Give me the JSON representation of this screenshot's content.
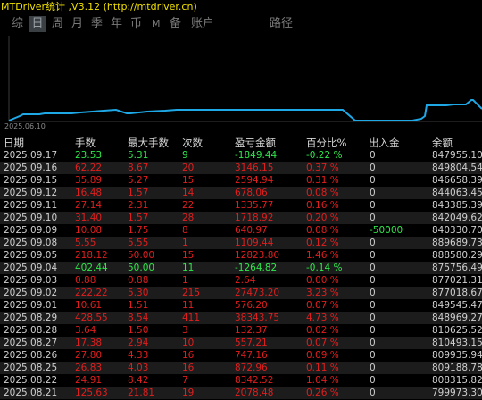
{
  "title": "MTDriver统计 ,V3.12 (http://mtdriver.cn)",
  "tabs": [
    {
      "label": "综",
      "active": false
    },
    {
      "label": "日",
      "active": true
    },
    {
      "label": "周",
      "active": false
    },
    {
      "label": "月",
      "active": false
    },
    {
      "label": "季",
      "active": false
    },
    {
      "label": "年",
      "active": false
    },
    {
      "label": "币",
      "active": false
    },
    {
      "label": "M",
      "active": false
    },
    {
      "label": "备",
      "active": false
    },
    {
      "label": "账户",
      "active": false
    },
    {
      "label": "路径",
      "active": false
    }
  ],
  "chart": {
    "start_date": "2025.06.10",
    "line_color": "#1ea8e6"
  },
  "colors": {
    "title": "#f0e000",
    "positive": "#e01e1e",
    "negative": "#2ee64a",
    "row_alt": "#1c1c1c"
  },
  "table": {
    "headers": {
      "date": "日期",
      "lots": "手数",
      "max_lots": "最大手数",
      "count": "次数",
      "pnl": "盈亏金额",
      "pct": "百分比%",
      "inout": "出入金",
      "balance": "余额"
    },
    "rows": [
      {
        "date": "2025.09.17",
        "lots": "23.53",
        "max_lots": "5.31",
        "count": "9",
        "pnl": "-1849.44",
        "pct": "-0.22 %",
        "inout": "0",
        "balance": "847955.10",
        "sign": "neg"
      },
      {
        "date": "2025.09.16",
        "lots": "62.22",
        "max_lots": "8.67",
        "count": "20",
        "pnl": "3146.15",
        "pct": "0.37 %",
        "inout": "0",
        "balance": "849804.54",
        "sign": "pos"
      },
      {
        "date": "2025.09.15",
        "lots": "35.89",
        "max_lots": "5.27",
        "count": "15",
        "pnl": "2594.94",
        "pct": "0.31 %",
        "inout": "0",
        "balance": "846658.39",
        "sign": "pos"
      },
      {
        "date": "2025.09.12",
        "lots": "16.48",
        "max_lots": "1.57",
        "count": "14",
        "pnl": "678.06",
        "pct": "0.08 %",
        "inout": "0",
        "balance": "844063.45",
        "sign": "pos"
      },
      {
        "date": "2025.09.11",
        "lots": "27.14",
        "max_lots": "2.31",
        "count": "22",
        "pnl": "1335.77",
        "pct": "0.16 %",
        "inout": "0",
        "balance": "843385.39",
        "sign": "pos"
      },
      {
        "date": "2025.09.10",
        "lots": "31.40",
        "max_lots": "1.57",
        "count": "28",
        "pnl": "1718.92",
        "pct": "0.20 %",
        "inout": "0",
        "balance": "842049.62",
        "sign": "pos"
      },
      {
        "date": "2025.09.09",
        "lots": "10.08",
        "max_lots": "1.75",
        "count": "8",
        "pnl": "640.97",
        "pct": "0.08 %",
        "inout": "-50000",
        "balance": "840330.70",
        "sign": "pos",
        "io_highlight": true
      },
      {
        "date": "2025.09.08",
        "lots": "5.55",
        "max_lots": "5.55",
        "count": "1",
        "pnl": "1109.44",
        "pct": "0.12 %",
        "inout": "0",
        "balance": "889689.73",
        "sign": "pos"
      },
      {
        "date": "2025.09.05",
        "lots": "218.12",
        "max_lots": "50.00",
        "count": "15",
        "pnl": "12823.80",
        "pct": "1.46 %",
        "inout": "0",
        "balance": "888580.29",
        "sign": "pos"
      },
      {
        "date": "2025.09.04",
        "lots": "402.44",
        "max_lots": "50.00",
        "count": "11",
        "pnl": "-1264.82",
        "pct": "-0.14 %",
        "inout": "0",
        "balance": "875756.49",
        "sign": "neg"
      },
      {
        "date": "2025.09.03",
        "lots": "0.88",
        "max_lots": "0.88",
        "count": "1",
        "pnl": "2.64",
        "pct": "0.00 %",
        "inout": "0",
        "balance": "877021.31",
        "sign": "pos"
      },
      {
        "date": "2025.09.02",
        "lots": "222.22",
        "max_lots": "5.30",
        "count": "215",
        "pnl": "27473.20",
        "pct": "3.23 %",
        "inout": "0",
        "balance": "877018.67",
        "sign": "pos"
      },
      {
        "date": "2025.09.01",
        "lots": "10.61",
        "max_lots": "1.51",
        "count": "11",
        "pnl": "576.20",
        "pct": "0.07 %",
        "inout": "0",
        "balance": "849545.47",
        "sign": "pos"
      },
      {
        "date": "2025.08.29",
        "lots": "428.55",
        "max_lots": "8.54",
        "count": "411",
        "pnl": "38343.75",
        "pct": "4.73 %",
        "inout": "0",
        "balance": "848969.27",
        "sign": "pos"
      },
      {
        "date": "2025.08.28",
        "lots": "3.64",
        "max_lots": "1.50",
        "count": "3",
        "pnl": "132.37",
        "pct": "0.02 %",
        "inout": "0",
        "balance": "810625.52",
        "sign": "pos"
      },
      {
        "date": "2025.08.27",
        "lots": "17.38",
        "max_lots": "2.94",
        "count": "10",
        "pnl": "557.21",
        "pct": "0.07 %",
        "inout": "0",
        "balance": "810493.15",
        "sign": "pos"
      },
      {
        "date": "2025.08.26",
        "lots": "27.80",
        "max_lots": "4.33",
        "count": "16",
        "pnl": "747.16",
        "pct": "0.09 %",
        "inout": "0",
        "balance": "809935.94",
        "sign": "pos"
      },
      {
        "date": "2025.08.25",
        "lots": "26.83",
        "max_lots": "4.03",
        "count": "16",
        "pnl": "872.96",
        "pct": "0.11 %",
        "inout": "0",
        "balance": "809188.78",
        "sign": "pos"
      },
      {
        "date": "2025.08.22",
        "lots": "24.91",
        "max_lots": "8.42",
        "count": "7",
        "pnl": "8342.52",
        "pct": "1.04 %",
        "inout": "0",
        "balance": "808315.82",
        "sign": "pos"
      },
      {
        "date": "2025.08.21",
        "lots": "125.63",
        "max_lots": "21.81",
        "count": "19",
        "pnl": "2078.48",
        "pct": "0.26 %",
        "inout": "0",
        "balance": "799973.30",
        "sign": "pos"
      }
    ]
  }
}
